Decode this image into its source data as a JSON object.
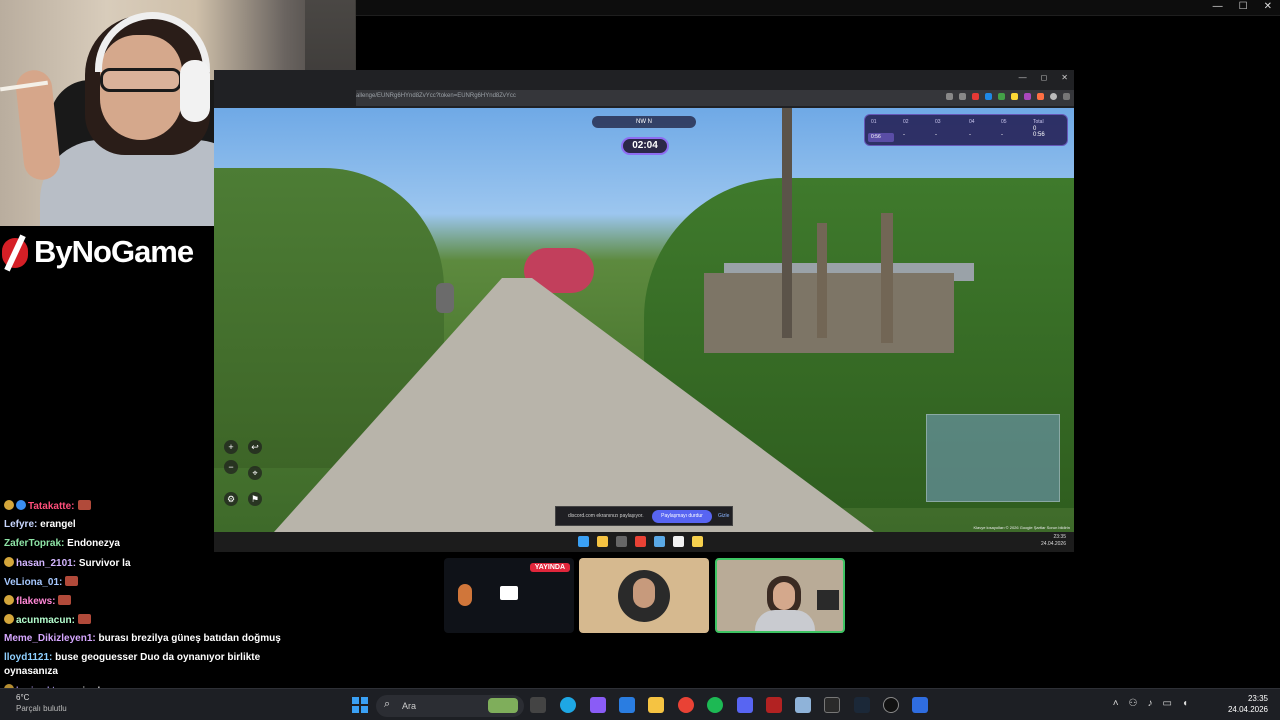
{
  "brand": {
    "name": "ByNoGame"
  },
  "browser": {
    "url": "allenge/EUNRg6HYnd8ZvYcc?token=EUNRg6HYnd8ZvYcc"
  },
  "game": {
    "compass": "NW       N",
    "timer": "02:04",
    "rounds": [
      {
        "label": "01",
        "value": ""
      },
      {
        "label": "02",
        "value": "-"
      },
      {
        "label": "03",
        "value": "-"
      },
      {
        "label": "04",
        "value": "-"
      },
      {
        "label": "05",
        "value": "-"
      },
      {
        "label": "Total",
        "value": "0"
      }
    ],
    "active_time": "0:56",
    "total_time": "0:56"
  },
  "share_bar": {
    "text": "discord.com ekranınızı paylaşıyor.",
    "stop_label": "Paylaşmayı durdur",
    "hide_label": "Gizle"
  },
  "map_attribution": "Klavye kısayolları  © 2026 Google  Şartlar  Sorun bildirin",
  "inner_clock": {
    "time": "23:35",
    "date": "24.04.2026"
  },
  "call": {
    "live_label": "YAYINDA"
  },
  "chat": [
    {
      "user": "Tatakatte:",
      "color": "#ff4f7b",
      "badge": true,
      "text": "",
      "emote": true
    },
    {
      "user": "Lefyre:",
      "color": "#c8d6ff",
      "badge": false,
      "text": "erangel",
      "emote": false
    },
    {
      "user": "ZaferToprak:",
      "color": "#8ee4a6",
      "badge": false,
      "text": "Endonezya",
      "emote": false
    },
    {
      "user": "hasan_2101:",
      "color": "#d3b5ff",
      "badge": true,
      "text": "Survivor la",
      "emote": false
    },
    {
      "user": "VeLiona_01:",
      "color": "#a6c8ff",
      "badge": false,
      "text": "",
      "emote": true
    },
    {
      "user": "flakews:",
      "color": "#ff88d6",
      "badge": true,
      "text": "",
      "emote": true
    },
    {
      "user": "acunmacun:",
      "color": "#b5ffcf",
      "badge": true,
      "text": "",
      "emote": true
    },
    {
      "user": "Meme_Dikizleyen1:",
      "color": "#d6a7ff",
      "badge": false,
      "text": "burası brezilya güneş batıdan doğmuş",
      "emote": false
    },
    {
      "user": "lloyd1121:",
      "color": "#8fd0ff",
      "badge": false,
      "text": "buse geoguesser Duo da oynanıyor birlikte",
      "emote": false
    },
    {
      "user": "",
      "color": "#ffffff",
      "badge": false,
      "text": "oynasanıza",
      "emote": false
    },
    {
      "user": "kasimoktm:",
      "color": "#b9a3ff",
      "badge": true,
      "text": "suriye bura",
      "emote": false
    }
  ],
  "taskbar": {
    "temperature": "6°C",
    "weather": "Parçalı bulutlu",
    "search_placeholder": "Ara",
    "time": "23:35",
    "date": "24.04.2026",
    "accent": "#3aa0f4"
  }
}
